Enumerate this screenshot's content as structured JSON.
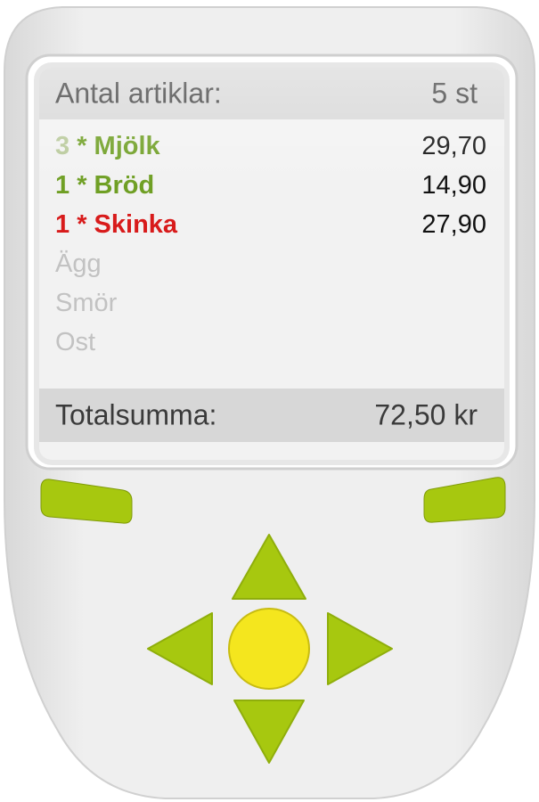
{
  "header": {
    "label": "Antal artiklar:",
    "value": "5 st"
  },
  "items": [
    {
      "qty": "3",
      "sep": " * ",
      "name": "Mjölk",
      "price": "29,70",
      "status": "selected-faded-qty"
    },
    {
      "qty": "1",
      "sep": " * ",
      "name": "Bröd",
      "price": "14,90",
      "status": "in-cart"
    },
    {
      "qty": "1",
      "sep": " * ",
      "name": "Skinka",
      "price": "27,90",
      "status": "alert"
    },
    {
      "name": "Ägg",
      "status": "not-added"
    },
    {
      "name": "Smör",
      "status": "not-added"
    },
    {
      "name": "Ost",
      "status": "not-added"
    }
  ],
  "footer": {
    "label": "Totalsumma:",
    "value": "72,50 kr"
  },
  "colors": {
    "green": "#6f9f24",
    "red": "#d81b1b",
    "button_green": "#a7c80f",
    "center_yellow": "#f4e61e",
    "muted_text": "#c2c2c2"
  },
  "controls": {
    "soft_left": "soft-key-left",
    "soft_right": "soft-key-right",
    "dpad": [
      "up-arrow-icon",
      "left-arrow-icon",
      "right-arrow-icon",
      "down-arrow-icon"
    ],
    "center": "center-select-button"
  }
}
